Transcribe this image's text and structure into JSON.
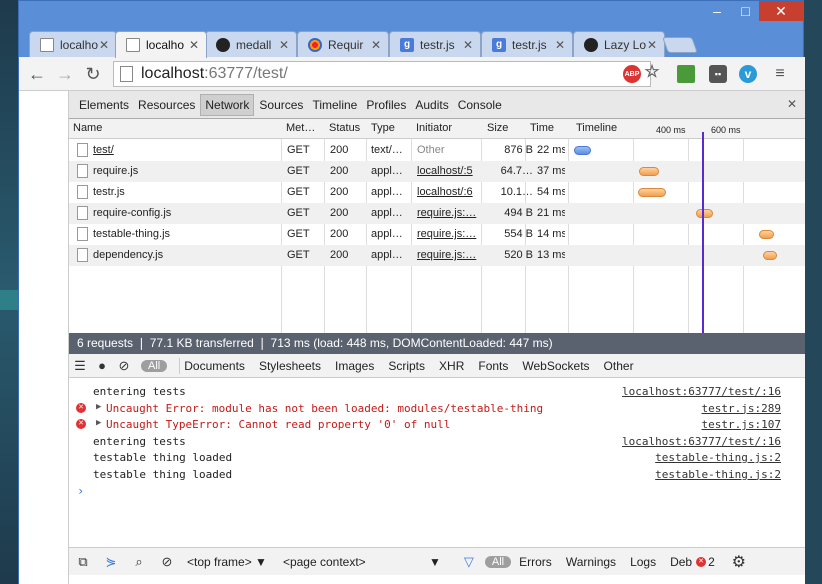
{
  "tabs": [
    {
      "title": "localho",
      "icon": "document-icon",
      "active": false
    },
    {
      "title": "localho",
      "icon": "document-icon",
      "active": true
    },
    {
      "title": "medall",
      "icon": "github-icon",
      "active": false
    },
    {
      "title": "Requir",
      "icon": "requirejs-icon",
      "active": false
    },
    {
      "title": "testr.js",
      "icon": "google-icon",
      "active": false
    },
    {
      "title": "testr.js",
      "icon": "google-icon",
      "active": false
    },
    {
      "title": "Lazy Lo",
      "icon": "github-icon",
      "active": false
    }
  ],
  "omnibox": {
    "host": "localhost",
    "rest": ":63777/test/"
  },
  "extensions": {
    "abp": "ABP"
  },
  "devtools": {
    "tabs": [
      "Elements",
      "Resources",
      "Network",
      "Sources",
      "Timeline",
      "Profiles",
      "Audits",
      "Console"
    ],
    "selected_tab": "Network"
  },
  "network": {
    "headers": {
      "name": "Name",
      "method": "Met…",
      "status": "Status",
      "type": "Type",
      "initiator": "Initiator",
      "size": "Size",
      "time": "Time",
      "timeline": "Timeline",
      "t400": "400 ms",
      "t600": "600 ms"
    },
    "rows": [
      {
        "name": "test/",
        "method": "GET",
        "status": "200",
        "type": "text/…",
        "initiator": "Other",
        "size": "876 B",
        "time": "22 ms"
      },
      {
        "name": "require.js",
        "method": "GET",
        "status": "200",
        "type": "appl…",
        "initiator": "localhost/:5",
        "size": "64.7…",
        "time": "37 ms"
      },
      {
        "name": "testr.js",
        "method": "GET",
        "status": "200",
        "type": "appl…",
        "initiator": "localhost/:6",
        "size": "10.1…",
        "time": "54 ms"
      },
      {
        "name": "require-config.js",
        "method": "GET",
        "status": "200",
        "type": "appl…",
        "initiator": "require.js:…",
        "size": "494 B",
        "time": "21 ms"
      },
      {
        "name": "testable-thing.js",
        "method": "GET",
        "status": "200",
        "type": "appl…",
        "initiator": "require.js:…",
        "size": "554 B",
        "time": "14 ms"
      },
      {
        "name": "dependency.js",
        "method": "GET",
        "status": "200",
        "type": "appl…",
        "initiator": "require.js:…",
        "size": "520 B",
        "time": "13 ms"
      }
    ],
    "summary": "6 requests ❘ 77.1 KB transferred ❘ 713 ms (load: 448 ms, DOMContentLoaded: 447 ms)"
  },
  "console_filter": {
    "all": "All",
    "items": [
      "Documents",
      "Stylesheets",
      "Images",
      "Scripts",
      "XHR",
      "Fonts",
      "WebSockets",
      "Other"
    ]
  },
  "console": {
    "lines": [
      {
        "kind": "log",
        "text": "entering tests",
        "source": "localhost:63777/test/:16"
      },
      {
        "kind": "error",
        "text": "Uncaught Error: module has not been loaded: modules/testable-thing",
        "source": "testr.js:289"
      },
      {
        "kind": "error",
        "text": "Uncaught TypeError: Cannot read property '0' of null",
        "source": "testr.js:107"
      },
      {
        "kind": "log",
        "text": "entering tests",
        "source": "localhost:63777/test/:16"
      },
      {
        "kind": "log",
        "text": "testable thing loaded",
        "source": "testable-thing.js:2"
      },
      {
        "kind": "log",
        "text": "testable thing loaded",
        "source": "testable-thing.js:2"
      }
    ],
    "prompt": "›"
  },
  "bottom_bar": {
    "frame": "<top frame>",
    "context": "<page context>",
    "all": "All",
    "levels": [
      "Errors",
      "Warnings",
      "Logs",
      "Deb"
    ],
    "debug_count": "2"
  }
}
